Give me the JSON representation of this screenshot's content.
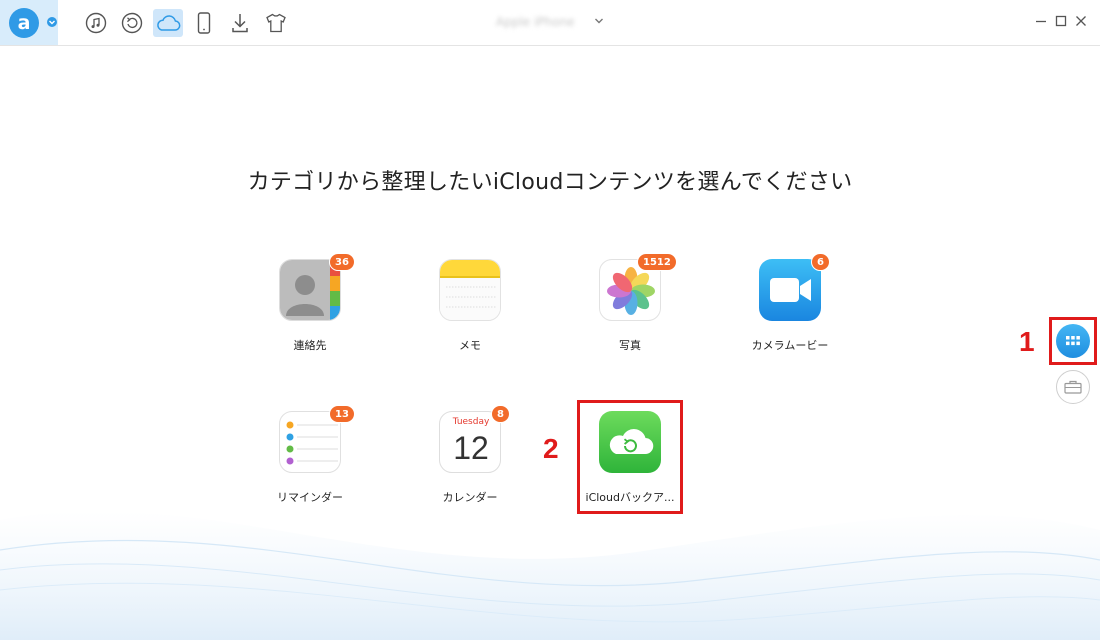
{
  "app": {
    "logo_letter": "a",
    "device_name": "Apple iPhone",
    "colors": {
      "accent": "#2f9ae6",
      "badge": "#f26b2a",
      "highlight": "#e01b1b"
    }
  },
  "toolbar": {
    "tools": [
      {
        "name": "music-icon",
        "active": false
      },
      {
        "name": "restore-icon",
        "active": false
      },
      {
        "name": "icloud-icon",
        "active": true
      },
      {
        "name": "phone-icon",
        "active": false
      },
      {
        "name": "download-icon",
        "active": false
      },
      {
        "name": "tshirt-icon",
        "active": false
      }
    ]
  },
  "main": {
    "headline": "カテゴリから整理したいiCloudコンテンツを選んでください",
    "categories": [
      {
        "label": "連絡先",
        "badge": "36",
        "icon": "contacts-icon"
      },
      {
        "label": "メモ",
        "badge": "",
        "icon": "notes-icon"
      },
      {
        "label": "写真",
        "badge": "1512",
        "icon": "photos-icon"
      },
      {
        "label": "カメラムービー",
        "badge": "6",
        "icon": "video-icon"
      },
      {
        "label": "リマインダー",
        "badge": "13",
        "icon": "reminders-icon"
      },
      {
        "label": "カレンダー",
        "badge": "8",
        "icon": "calendar-icon",
        "day": "Tuesday",
        "date": "12"
      },
      {
        "label": "iCloudバックア...",
        "badge": "",
        "icon": "icloud-backup-icon"
      }
    ]
  },
  "annotations": {
    "step1": "1",
    "step2": "2"
  },
  "side": {
    "buttons": [
      {
        "name": "category-view-icon",
        "active": true
      },
      {
        "name": "toolbox-icon",
        "active": false
      }
    ]
  }
}
